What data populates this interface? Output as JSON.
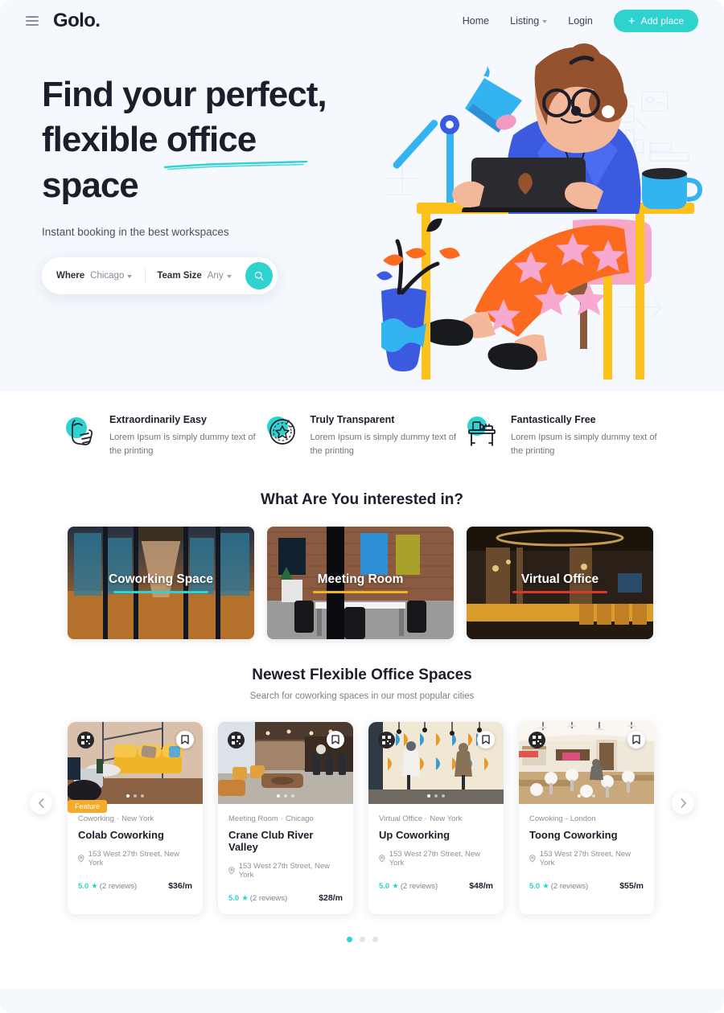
{
  "header": {
    "logo": "Golo.",
    "menu_icon": "hamburger-icon",
    "nav": [
      {
        "label": "Home",
        "has_caret": false
      },
      {
        "label": "Listing",
        "has_caret": true
      },
      {
        "label": "Login",
        "has_caret": false
      }
    ],
    "add_place_label": "Add place",
    "accent": "#2ed3cf"
  },
  "hero": {
    "title_line1": "Find your perfect,",
    "title_line2a": "flexible ",
    "title_line2b": "office",
    "title_line3": "space",
    "subtitle": "Instant booking in the best workspaces",
    "search": {
      "where_label": "Where",
      "where_value": "Chicago",
      "team_label": "Team Size",
      "team_value": "Any",
      "search_icon": "search-icon"
    }
  },
  "features": [
    {
      "icon": "hand-tap-icon",
      "title": "Extraordinarily Easy",
      "text": "Lorem Ipsum is simply dummy text of the printing"
    },
    {
      "icon": "badge-star-icon",
      "title": "Truly Transparent",
      "text": "Lorem Ipsum is simply dummy text of the printing"
    },
    {
      "icon": "desk-coffee-icon",
      "title": "Fantastically Free",
      "text": "Lorem Ipsum is simply dummy text of the printing"
    }
  ],
  "interest": {
    "title": "What Are You interested in?",
    "categories": [
      {
        "label": "Coworking Space",
        "underline_color": "#2ed3cf"
      },
      {
        "label": "Meeting Room",
        "underline_color": "#f5b324"
      },
      {
        "label": "Virtual Office",
        "underline_color": "#e0352b"
      }
    ]
  },
  "listings": {
    "title": "Newest Flexible Office Spaces",
    "subtitle": "Search for coworking spaces in our most popular cities",
    "prev_label": "‹",
    "next_label": "›",
    "cards": [
      {
        "category": "Coworking",
        "city": "New York",
        "name": "Colab Coworking",
        "address": "153 West 27th Street, New York",
        "rating": "5.0",
        "reviews": "(2 reviews)",
        "price": "$36/m",
        "badge": "Feature",
        "image_dots": 3,
        "image_dot_active": 0
      },
      {
        "category": "Meeting Room",
        "city": "Chicago",
        "name": "Crane Club River Valley",
        "address": "153 West 27th Street, New York",
        "rating": "5.0",
        "reviews": "(2 reviews)",
        "price": "$28/m",
        "badge": "",
        "image_dots": 3,
        "image_dot_active": 0
      },
      {
        "category": "Virtual Office",
        "city": "New York",
        "name": "Up Coworking",
        "address": "153 West 27th Street, New York",
        "rating": "5.0",
        "reviews": "(2 reviews)",
        "price": "$48/m",
        "badge": "",
        "image_dots": 3,
        "image_dot_active": 0
      },
      {
        "category": "Cowoking",
        "city": "London",
        "name": "Toong Coworking",
        "address": "153 West 27th Street, New York",
        "rating": "5.0",
        "reviews": "(2 reviews)",
        "price": "$55/m",
        "badge": "",
        "image_dots": 3,
        "image_dot_active": 0
      }
    ],
    "pager": {
      "count": 3,
      "active": 0
    }
  }
}
